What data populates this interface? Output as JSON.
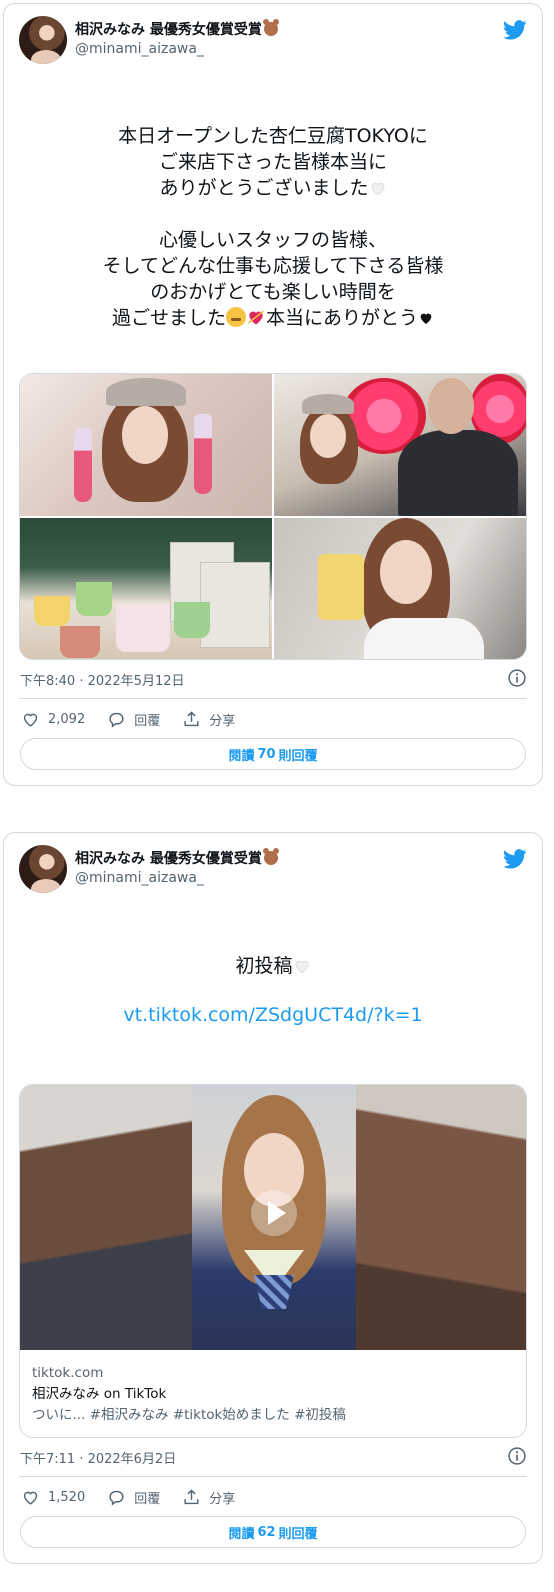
{
  "tweets": [
    {
      "author": {
        "display_name": "相沢みなみ 最優秀女優賞受賞",
        "handle": "@minami_aizawa_",
        "badge_icon": "teddy-bear-emoji"
      },
      "text_lines": [
        "本日オープンした杏仁豆腐TOKYOに",
        "ご来店下さった皆様本当に",
        "ありがとうございました",
        "心優しいスタッフの皆様、",
        "そしてどんな仕事も応援して下さる皆様",
        "のおかげとても楽しい時間を",
        "過ごせました",
        "本当にありがとう"
      ],
      "timestamp": "下午8:40 · 2022年5月12日",
      "likes": "2,092",
      "reply_label": "回覆",
      "share_label": "分享",
      "read_button": {
        "prefix": "閱讀 ",
        "count": "70",
        "suffix": " 則回覆"
      }
    },
    {
      "author": {
        "display_name": "相沢みなみ 最優秀女優賞受賞",
        "handle": "@minami_aizawa_",
        "badge_icon": "teddy-bear-emoji"
      },
      "text": "初投稿",
      "link": "vt.tiktok.com/ZSdgUCT4d/?k=1",
      "card": {
        "domain": "tiktok.com",
        "title": "相沢みなみ on TikTok",
        "description": "ついに... #相沢みなみ #tiktok始めました #初投稿"
      },
      "timestamp": "下午7:11 · 2022年6月2日",
      "likes": "1,520",
      "reply_label": "回覆",
      "share_label": "分享",
      "read_button": {
        "prefix": "閱讀 ",
        "count": "62",
        "suffix": " 則回覆"
      }
    }
  ],
  "colors": {
    "link": "#1d9bf0",
    "twitter_blue": "#1d9bf0",
    "muted": "#536471",
    "border": "#cfd9de"
  }
}
